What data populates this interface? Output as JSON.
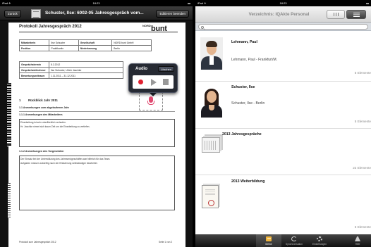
{
  "left_app": {
    "status": {
      "carrier": "iPad ✈︎",
      "time": "18:23",
      "battery": "▬"
    },
    "navbar": {
      "back_label": "Zurück",
      "title": "Schuster, Ilse: 6002-05 Jahresgespräch vom...",
      "edit_label": "Editieren beenden"
    },
    "document": {
      "heading": "Protokoll Jahresgespräch 2012",
      "logo_small": "NORD",
      "logo_big": "bunt",
      "header_table": [
        [
          "Mitarbeiterin",
          "Ilse Schuster",
          "Gesellschaft",
          "NORD bunt GmbH"
        ],
        [
          "Position",
          "Praktikantin",
          "Niederlassung",
          "Berlin"
        ]
      ],
      "meta_table": [
        [
          "Gesprächstermin",
          "8.2.2012"
        ],
        [
          "Gesprächsteilnehmer",
          "Ilse Schuster, Ulrich Jaschke"
        ],
        [
          "Bewertungszeitraum",
          "1.11.2011 – 31.12.2011"
        ]
      ],
      "section_num": "1",
      "section_title": "Rückblick Jahr 2011",
      "sub1": "1.1    Anmerkungen zum abgelaufenen Jahr",
      "sub11": "1.1.1      Anmerkungen des Mitarbeiters",
      "text11_a": "Einarbeitung ist sehr oberflächlich verlaufen.",
      "text11_b": "Hr. Jaschke nimmt sich kaum Zeit um die Einarbeitung zu vertiefen.",
      "sub12": "1.1.2      Anmerkungen des Vorgesetzten",
      "text12_a": "Der Einsatz bei der Unterstützung des Jahresendgeschäftes war hilfreich für das Team.",
      "text12_b": "Aufgaben müssen zukünftig nach der Erläuterung selbständiger bearbeitet.",
      "footer_left": "Protokoll zum Jahresgespräch 2012",
      "footer_right": "Seite 1 von 2"
    },
    "audio_popover": {
      "title": "Audio",
      "clear_label": "Löschen"
    }
  },
  "right_app": {
    "status": {
      "carrier": "iPad ✈︎",
      "time": "18:23",
      "battery": "▬"
    },
    "navbar": {
      "title": "Verzeichnis: IQAkte Personal"
    },
    "search": {
      "placeholder": ""
    },
    "rows": [
      {
        "name": "Lehmann, Paul",
        "subtitle": "Lehmann, Paul - Frankfurt/M.",
        "count": "5 Elemente"
      },
      {
        "name": "Schuster, Ilse",
        "subtitle": "Schuster, Ilse - Berlin",
        "count": "5 Elemente"
      },
      {
        "name": "2013 Jahresgespräche",
        "count": "22 Elemente"
      },
      {
        "name": "2013 Weiterbildung",
        "count": "5 Elemente"
      }
    ],
    "tabbar": [
      {
        "label": "Meine",
        "icon": "folder-icon",
        "active": true
      },
      {
        "label": "Synchronisation",
        "icon": "sync-icon",
        "active": false
      },
      {
        "label": "Einstellungen",
        "icon": "settings-icon",
        "active": false
      },
      {
        "label": "Hilfe",
        "icon": "help-icon",
        "active": false
      }
    ]
  }
}
